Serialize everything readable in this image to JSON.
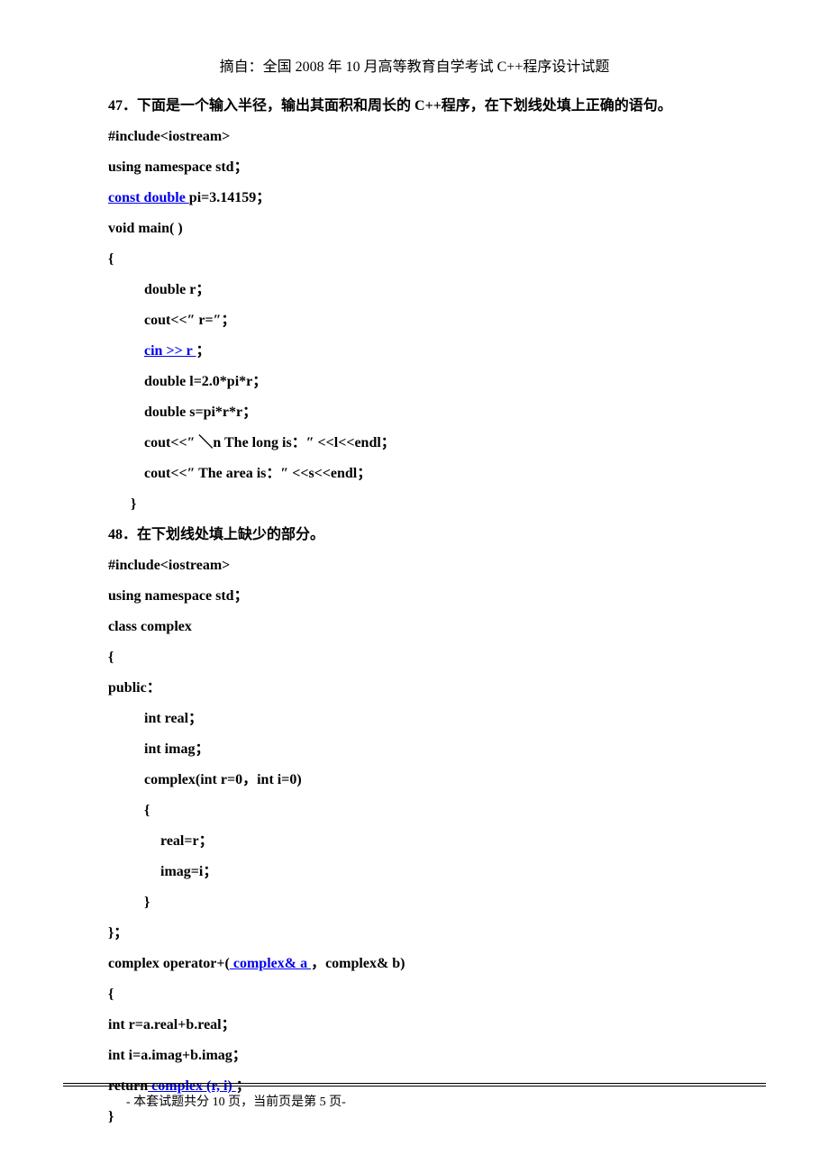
{
  "header": "摘自：全国 2008 年 10 月高等教育自学考试 C++程序设计试题",
  "q47": {
    "num": "47．",
    "prompt": "下面是一个输入半径，输出其面积和周长的 C++程序，在下划线处填上正确的语句。",
    "code": {
      "l1": "#include<iostream>",
      "l2": "using namespace std；",
      "blank1_pre": "  ",
      "blank1": "const double  ",
      "l3_post": "pi=3.14159；",
      "l4": "void main( )",
      "l5": "{",
      "l6": "double r；",
      "l7": "cout<<″ r=″；",
      "blank2_pre": "  ",
      "blank2": "  cin >> r    ",
      "l8_post": "；",
      "l9": "double l=2.0*pi*r；",
      "l10": "double s=pi*r*r；",
      "l11": "cout<<″ ＼n The long is：″ <<l<<endl；",
      "l12": "cout<<″ The area is：″ <<s<<endl；",
      "l13": "}"
    }
  },
  "q48": {
    "num": "48．",
    "prompt": "在下划线处填上缺少的部分。",
    "code": {
      "l1": "#include<iostream>",
      "l2": "using namespace std；",
      "l3": "class complex",
      "l4": "{",
      "l5": "public：",
      "l6": "int real；",
      "l7": "int imag；",
      "l8": "complex(int r=0，int i=0)",
      "l9": "{",
      "l10": "real=r；",
      "l11": "imag=i；",
      "l12": "}",
      "l13": "}；",
      "l14_pre": "complex operator+(",
      "blank1": "    complex& a     ",
      "l14_post": "，complex& b)",
      "l15": "{",
      "l16": "int r=a.real+b.real；",
      "l17": "int i=a.imag+b.imag；",
      "l18_pre": "return",
      "blank2": "    complex (r, i)    ",
      "l18_post": "；",
      "l19": "}"
    }
  },
  "footer": "- 本套试题共分 10 页，当前页是第 5 页-"
}
